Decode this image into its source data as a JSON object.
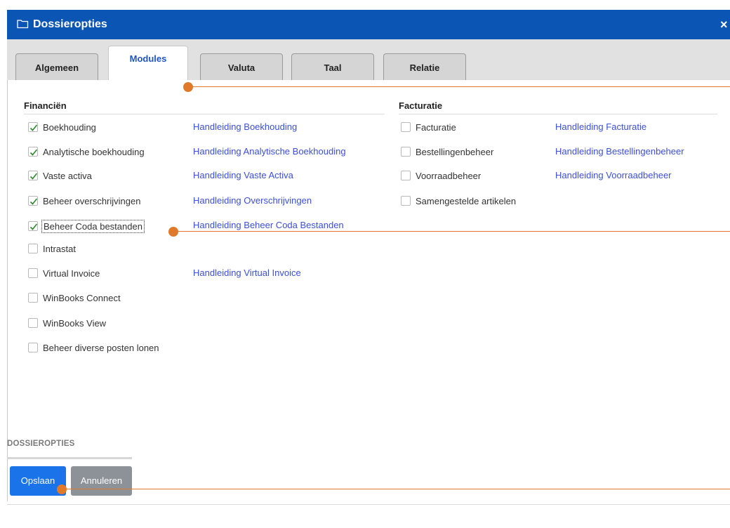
{
  "window": {
    "title": "Dossieropties",
    "folder_icon": "folder-icon",
    "close_icon": "close-icon",
    "close_label": "×"
  },
  "tabs": [
    {
      "label": "Algemeen",
      "active": false
    },
    {
      "label": "Modules",
      "active": true
    },
    {
      "label": "Valuta",
      "active": false
    },
    {
      "label": "Taal",
      "active": false
    },
    {
      "label": "Relatie",
      "active": false
    }
  ],
  "financien": {
    "header": "Financiën",
    "items": [
      {
        "label": "Boekhouding",
        "checked": true,
        "link": "Handleiding Boekhouding"
      },
      {
        "label": "Analytische boekhouding",
        "checked": true,
        "link": "Handleiding Analytische Boekhouding"
      },
      {
        "label": "Vaste activa",
        "checked": true,
        "link": "Handleiding Vaste Activa"
      },
      {
        "label": "Beheer overschrijvingen",
        "checked": true,
        "link": "Handleiding Overschrijvingen"
      },
      {
        "label": "Beheer Coda bestanden",
        "checked": true,
        "link": "Handleiding Beheer Coda Bestanden"
      },
      {
        "label": "Intrastat",
        "checked": false,
        "link": ""
      },
      {
        "label": "Virtual Invoice",
        "checked": false,
        "link": "Handleiding Virtual Invoice"
      },
      {
        "label": "WinBooks Connect",
        "checked": false,
        "link": ""
      },
      {
        "label": "WinBooks View",
        "checked": false,
        "link": ""
      },
      {
        "label": "Beheer diverse posten lonen",
        "checked": false,
        "link": ""
      }
    ]
  },
  "facturatie": {
    "header": "Facturatie",
    "items": [
      {
        "label": "Facturatie",
        "checked": false,
        "link": "Handleiding Facturatie"
      },
      {
        "label": "Bestellingenbeheer",
        "checked": false,
        "link": "Handleiding Bestellingenbeheer"
      },
      {
        "label": "Voorraadbeheer",
        "checked": false,
        "link": "Handleiding Voorraadbeheer"
      },
      {
        "label": "Samengestelde artikelen",
        "checked": false,
        "link": ""
      }
    ]
  },
  "footer": {
    "title": "DOSSIEROPTIES",
    "save_label": "Opslaan",
    "cancel_label": "Annuleren"
  },
  "colors": {
    "titlebar": "#0b55b5",
    "link": "#3b4fd8",
    "primary_button": "#1a73e8",
    "secondary_button": "#8d9299",
    "callout": "#e07a2a"
  }
}
